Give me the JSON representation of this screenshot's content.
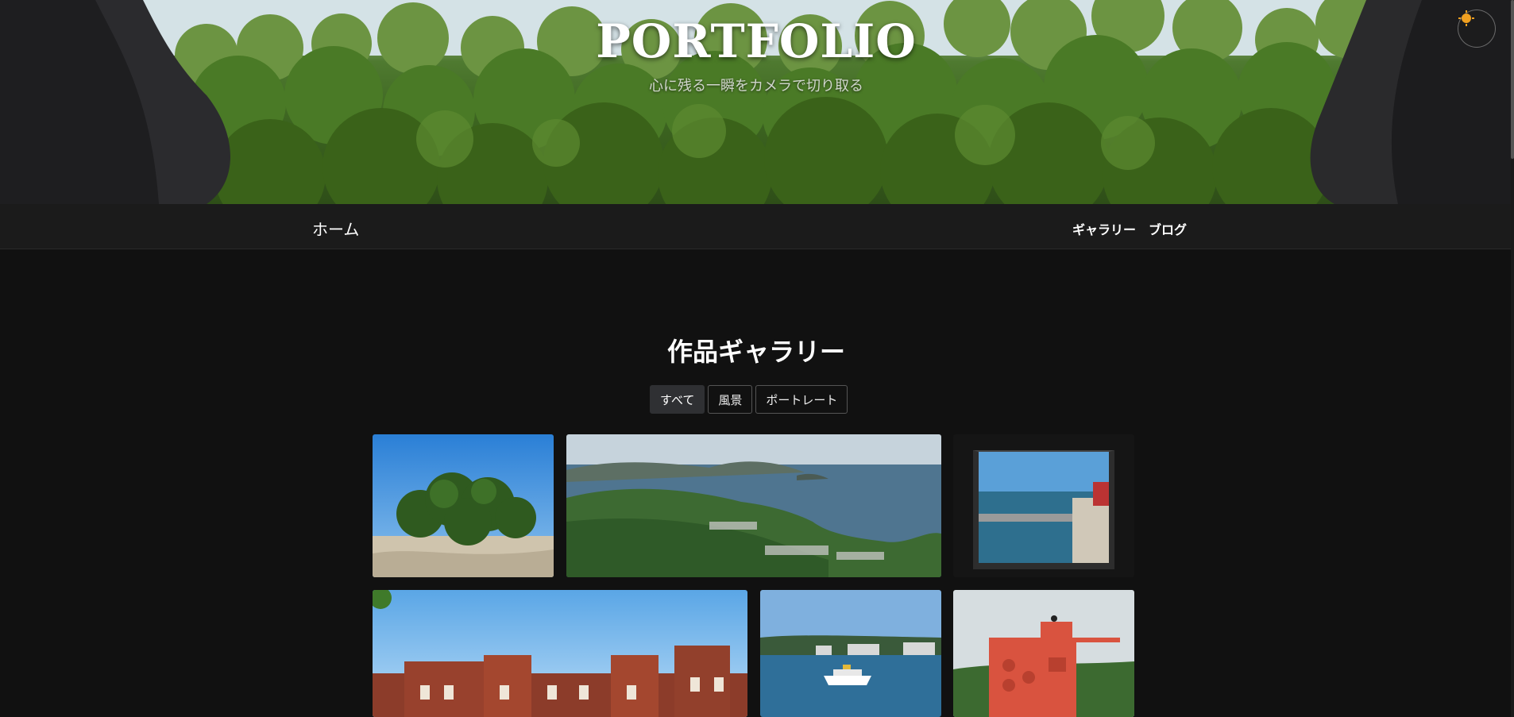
{
  "hero": {
    "title": "PORTFOLIO",
    "subtitle": "心に残る一瞬をカメラで切り取る",
    "theme_toggle_icon": "sun-icon"
  },
  "nav": {
    "home_label": "ホーム",
    "links": [
      "ギャラリー",
      "ブログ"
    ]
  },
  "gallery": {
    "title": "作品ギャラリー",
    "filters": [
      {
        "label": "すべて",
        "active": true
      },
      {
        "label": "風景",
        "active": false
      },
      {
        "label": "ポートレート",
        "active": false
      }
    ],
    "photos": [
      {
        "subject": "island-beach"
      },
      {
        "subject": "coastal-panorama"
      },
      {
        "subject": "harbor-window"
      },
      {
        "subject": "brick-building"
      },
      {
        "subject": "ferry-boat"
      },
      {
        "subject": "red-tower"
      }
    ]
  },
  "colors": {
    "background": "#111111",
    "navbar": "#1b1b1b",
    "active_filter": "#2f3033",
    "sun": "#f0a020"
  }
}
